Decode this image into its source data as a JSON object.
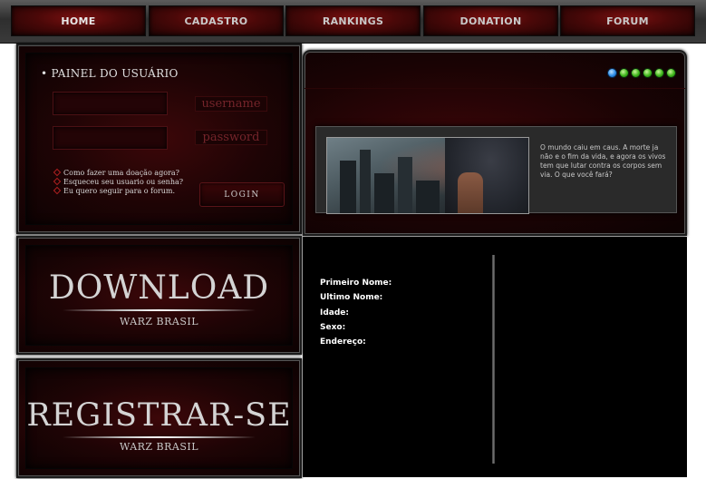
{
  "nav": {
    "items": [
      {
        "label": "HOME"
      },
      {
        "label": "CADASTRO"
      },
      {
        "label": "RANKINGS"
      },
      {
        "label": "DONATION"
      },
      {
        "label": "FORUM"
      }
    ]
  },
  "login": {
    "title": "• PAINEL DO USUÁRIO",
    "username_label": "username",
    "password_label": "password",
    "links": [
      "Como fazer uma doação agora?",
      "Esqueceu seu usuario ou senha?",
      "Eu quero seguir para o forum."
    ],
    "button_label": "LOGIN"
  },
  "download_banner": {
    "title": "DOWNLOAD",
    "subtitle": "WARZ BRASIL"
  },
  "register_banner": {
    "title": "REGISTRAR-SE",
    "subtitle": "WARZ BRASIL"
  },
  "slider": {
    "dot_count": 6,
    "active_index": 0,
    "active_color": "#2d8de8",
    "inactive_color": "#3db51a"
  },
  "news": {
    "text": "O mundo caiu em caus. A morte ja não e o fim da vida, e agora os vivos tem que lutar contra os corpos sem via. O que você fará?"
  },
  "profile": {
    "fields": [
      {
        "label": "Primeiro Nome:"
      },
      {
        "label": "Ultimo Nome:"
      },
      {
        "label": "Idade:"
      },
      {
        "label": "Sexo:"
      },
      {
        "label": "Endereço:"
      }
    ]
  },
  "colors": {
    "accent_red": "#7a1010",
    "panel_dark": "#1a0304",
    "text_light": "#e0e0e0"
  }
}
